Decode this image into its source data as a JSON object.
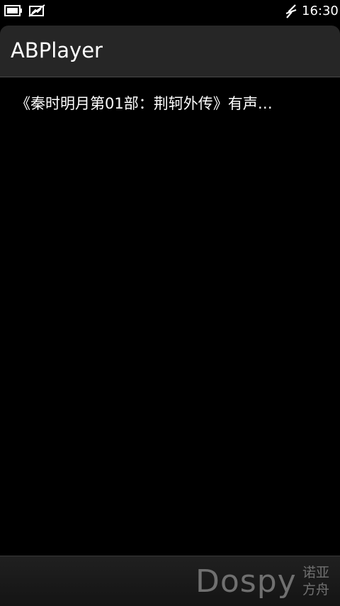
{
  "status_bar": {
    "time": "16:30",
    "icons": [
      "battery-icon",
      "signal-off-icon",
      "network-icon"
    ]
  },
  "header": {
    "title": "ABPlayer"
  },
  "list": {
    "items": [
      {
        "label": "《秦时明月第01部：荆轲外传》有声…"
      }
    ]
  },
  "toolbar": {
    "watermark": {
      "word": "Dospy",
      "cn_line1": "诺亚",
      "cn_line2": "方舟"
    }
  },
  "colors": {
    "background": "#000000",
    "title_bar": "#262626",
    "toolbar": "#1a1a1a",
    "watermark": "#707070"
  }
}
